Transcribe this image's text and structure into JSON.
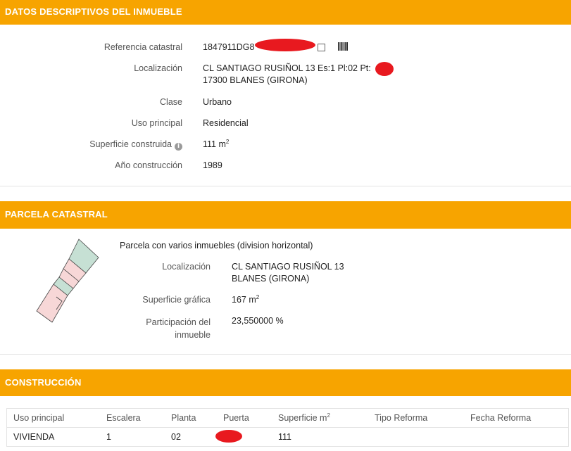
{
  "inmueble": {
    "header": "DATOS DESCRIPTIVOS DEL INMUEBLE",
    "referencia_label": "Referencia catastral",
    "referencia_value": "1847911DG8",
    "localizacion_label": "Localización",
    "localizacion_line1": "CL SANTIAGO RUSIÑOL 13 Es:1 Pl:02 Pt:",
    "localizacion_line2": "17300 BLANES (GIRONA)",
    "clase_label": "Clase",
    "clase_value": "Urbano",
    "uso_label": "Uso principal",
    "uso_value": "Residencial",
    "superficie_label": "Superficie construida",
    "superficie_value": "111 m",
    "superficie_unit_sup": "2",
    "anio_label": "Año construcción",
    "anio_value": "1989"
  },
  "parcela": {
    "header": "PARCELA CATASTRAL",
    "descripcion": "Parcela con varios inmuebles (division horizontal)",
    "localizacion_label": "Localización",
    "localizacion_line1": "CL SANTIAGO RUSIÑOL 13",
    "localizacion_line2": "BLANES (GIRONA)",
    "superficie_label": "Superficie gráfica",
    "superficie_value": "167 m",
    "superficie_unit_sup": "2",
    "participacion_label_1": "Participación del",
    "participacion_label_2": "inmueble",
    "participacion_value": "23,550000 %"
  },
  "construccion": {
    "header": "CONSTRUCCIÓN",
    "columns": [
      "Uso principal",
      "Escalera",
      "Planta",
      "Puerta",
      "Superficie m",
      "Tipo Reforma",
      "Fecha Reforma"
    ],
    "superficie_sup": "2",
    "row": {
      "uso": "VIVIENDA",
      "escalera": "1",
      "planta": "02",
      "puerta": "",
      "superficie": "111",
      "tipo_reforma": "",
      "fecha_reforma": ""
    }
  },
  "icons": {
    "info": "info-icon",
    "checkbox": "checkbox-icon",
    "barcode": "barcode-icon"
  },
  "colors": {
    "header_bg": "#f7a400",
    "header_text": "#ffffff",
    "redaction": "#e8191f",
    "parcel_green": "#c6e0d4",
    "parcel_pink": "#f7d7d7"
  }
}
